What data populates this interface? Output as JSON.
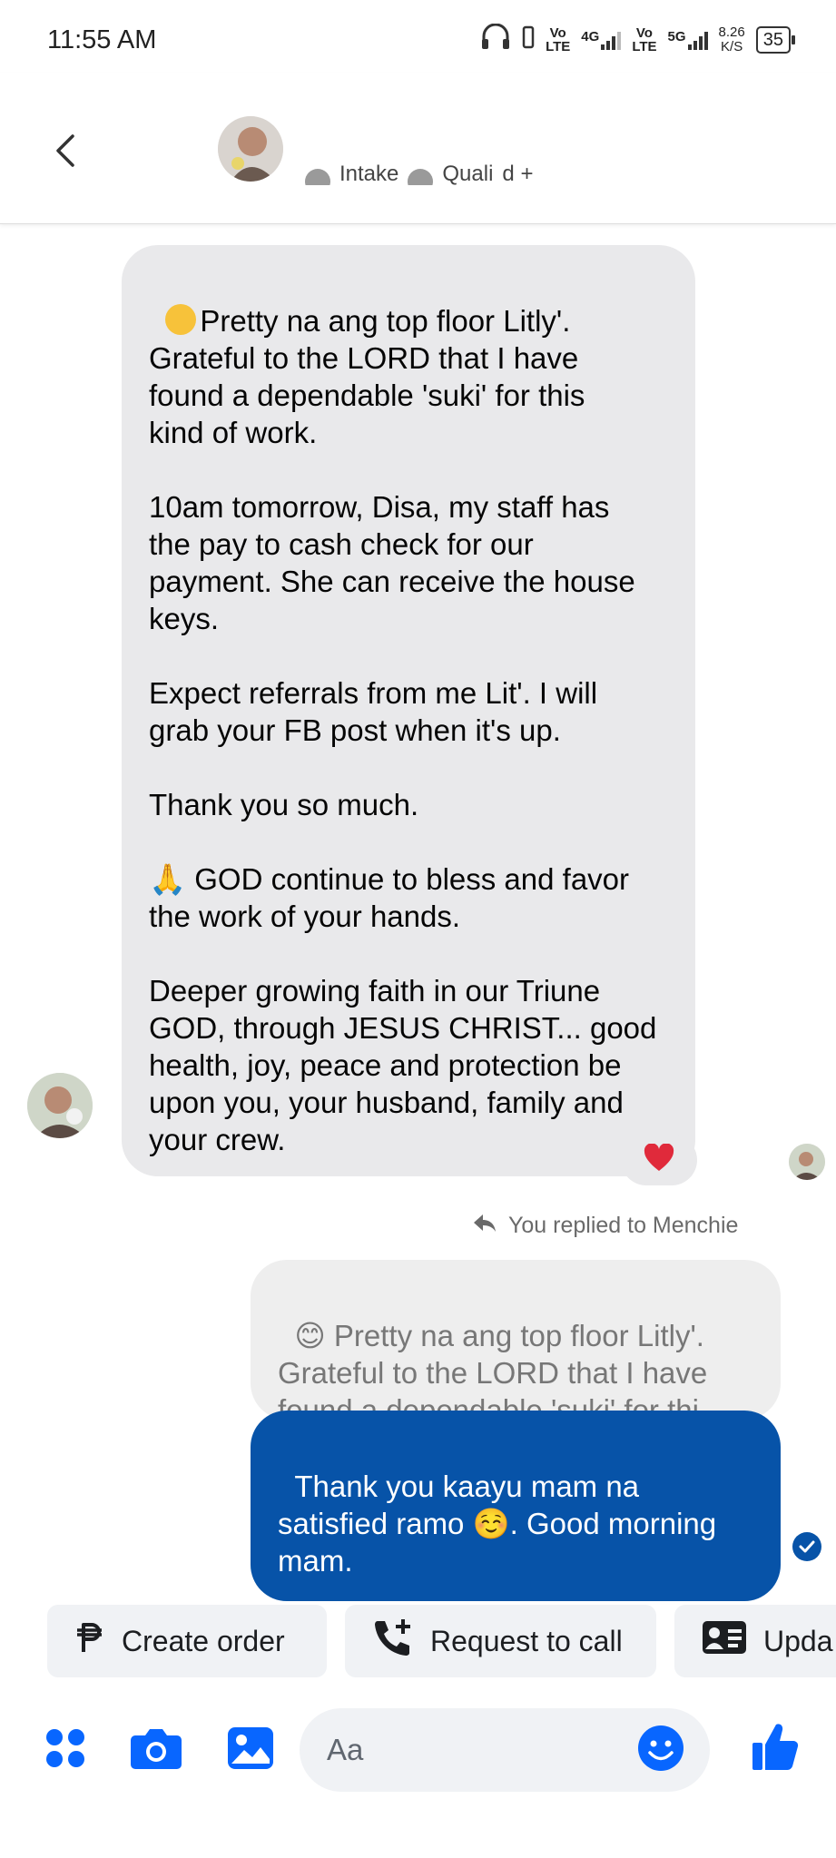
{
  "status_bar": {
    "time": "11:55 AM",
    "net1_top": "Vo",
    "net1_bottom": "LTE",
    "net1_gen": "4G",
    "net2_top": "Vo",
    "net2_bottom": "LTE",
    "net2_gen": "5G",
    "speed_value": "8.26",
    "speed_unit": "K/S",
    "battery": "35"
  },
  "header": {
    "labels": [
      "Intake",
      "Quali",
      "d +"
    ]
  },
  "incoming_message": {
    "text": "Pretty na ang top floor Litly'.\nGrateful to the LORD that I have\nfound a dependable 'suki' for this\nkind of work.\n\n10am tomorrow, Disa, my staff has\nthe pay to cash check for our\npayment. She can receive the house\nkeys.\n\nExpect referrals from me Lit'. I will\ngrab your FB post when it's up.\n\nThank you so much.\n\n🙏 GOD continue to bless and favor\nthe work of your hands.\n\nDeeper growing faith in our Triune\nGOD, through JESUS CHRIST... good\nhealth, joy, peace and protection be\nupon you, your husband, family and\nyour crew.",
    "reaction": "❤️"
  },
  "reply": {
    "context_label": "You replied to Menchie",
    "quoted_text": "😊 Pretty na ang top floor Litly'.\nGrateful to the LORD that I have\nfound a dependable 'suki' for thi...",
    "text": "Thank you kaayu mam na\nsatisfied ramo ☺️. Good morning\nmam."
  },
  "quick_actions": [
    {
      "label": "Create order"
    },
    {
      "label": "Request to call"
    },
    {
      "label": "Upda"
    }
  ],
  "composer": {
    "placeholder": "Aa"
  },
  "colors": {
    "accent": "#0866ff",
    "outgoing_bubble": "#0753a8",
    "incoming_bubble": "#e9e9eb"
  }
}
